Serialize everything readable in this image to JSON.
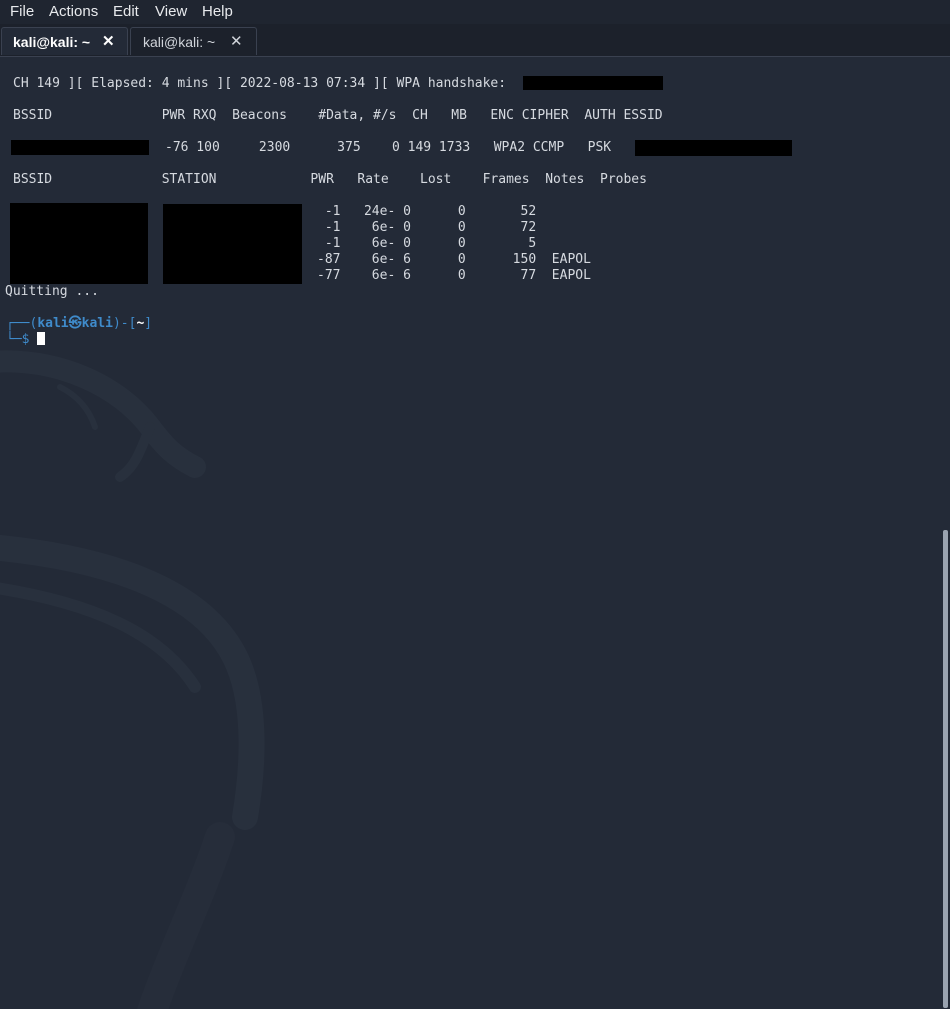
{
  "menubar": {
    "items": [
      "File",
      "Actions",
      "Edit",
      "View",
      "Help"
    ]
  },
  "tabs": [
    {
      "label": "kali@kali: ~",
      "close": "✕"
    },
    {
      "label": "kali@kali: ~",
      "close": "✕"
    }
  ],
  "terminal": {
    "status_line": "CH 149 ][ Elapsed: 4 mins ][ 2022-08-13 07:34 ][ WPA handshake:",
    "ap_header": "BSSID              PWR RXQ  Beacons    #Data, #/s  CH   MB   ENC CIPHER  AUTH ESSID",
    "ap_row": "-76 100     2300      375    0 149 1733   WPA2 CCMP   PSK",
    "station_header": "BSSID              STATION            PWR   Rate    Lost    Frames  Notes  Probes",
    "station_rows": [
      " -1   24e- 0      0       52",
      " -1    6e- 0      0       72",
      " -1    6e- 0      0        5",
      "-87    6e- 6      0      150  EAPOL",
      "-77    6e- 6      0       77  EAPOL"
    ],
    "quitting": "Quitting ...",
    "prompt": {
      "frame_top_left": "┌──(",
      "user": "kali",
      "at": "㉿",
      "host": "kali",
      "frame_mid": ")-[",
      "dir": "~",
      "frame_end": "]",
      "frame_bottom": "└─$"
    }
  },
  "colors": {
    "background": "#232a37",
    "prompt_blue": "#3f8bcb",
    "text": "#d6dae0"
  }
}
